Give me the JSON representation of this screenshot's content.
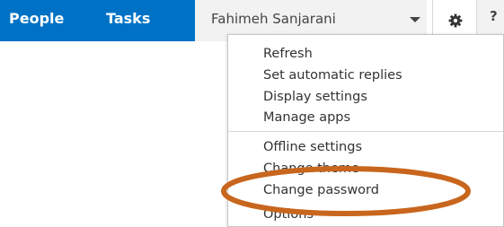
{
  "nav": {
    "people_label": "People",
    "tasks_label": "Tasks",
    "bar_color": "#0072c6"
  },
  "user": {
    "name": "Fahimeh Sanjarani"
  },
  "icons": {
    "settings": "gear-icon",
    "user_menu": "chevron-down-icon"
  },
  "settings_menu": {
    "items": [
      "Refresh",
      "Set automatic replies",
      "Display settings",
      "Manage apps",
      "Offline settings",
      "Change theme",
      "Change password",
      "Options"
    ]
  },
  "annotation": {
    "shape": "ellipse",
    "color": "#c8661e"
  }
}
